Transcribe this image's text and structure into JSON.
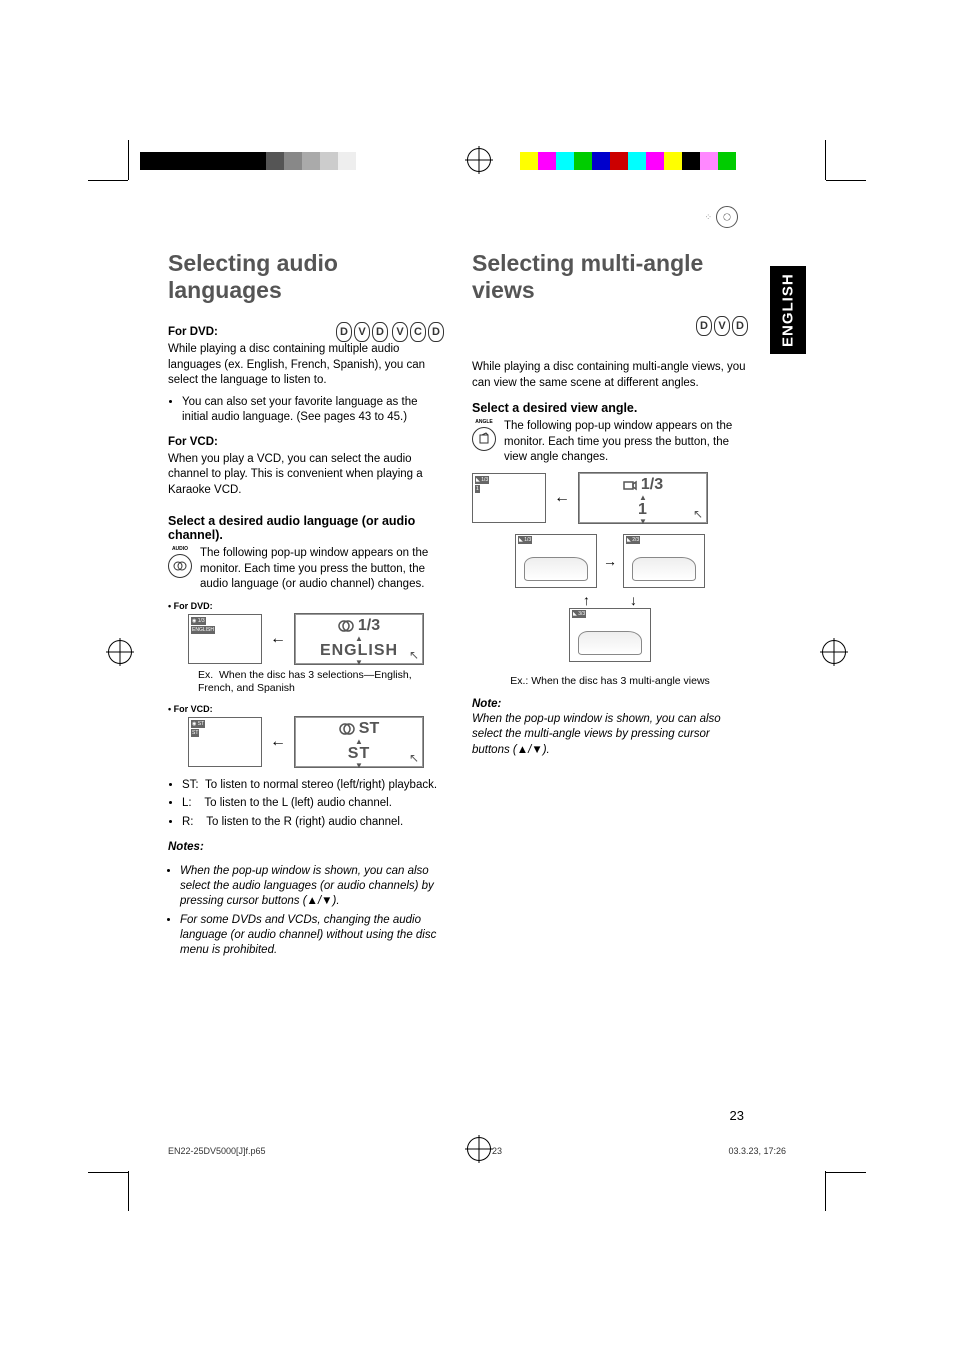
{
  "side_tab": "ENGLISH",
  "page_number": "23",
  "footer": {
    "file": "EN22-25DV5000[J]f.p65",
    "page": "23",
    "timestamp": "03.3.23, 17:26"
  },
  "left": {
    "heading": "Selecting audio languages",
    "for_dvd_label": "For DVD:",
    "for_dvd_body": "While playing a disc containing multiple audio languages (ex. English, French, Spanish), you can select the language to listen to.",
    "for_dvd_bullet": "You can also set your favorite language as the initial audio language. (See pages 43 to 45.)",
    "for_vcd_label": "For VCD:",
    "for_vcd_body": "When you play a VCD, you can select the audio channel to play. This is convenient when playing a Karaoke VCD.",
    "select_head": "Select a desired audio language (or audio channel).",
    "popup_body": "The following pop-up window appears on the monitor. Each time you press the button, the audio language (or audio channel) changes.",
    "button_label": "AUDIO",
    "for_dvd_tiny": "• For DVD:",
    "popup_dvd_top": "1/3",
    "popup_dvd_val": "ENGLISH",
    "caption_dvd_prefix": "Ex.",
    "caption_dvd": "When the disc has 3 selections—English, French, and Spanish",
    "for_vcd_tiny": "• For VCD:",
    "popup_vcd_top": "ST",
    "popup_vcd_val": "ST",
    "defs": {
      "st": "To listen to normal stereo (left/right) playback.",
      "l": "To listen to the L (left) audio channel.",
      "r": "To listen to the R (right) audio channel."
    },
    "def_labels": {
      "st": "ST:",
      "l": "L:",
      "r": "R:"
    },
    "notes_head": "Notes:",
    "notes": [
      "When the pop-up window is shown, you can also select the audio languages (or audio channels) by pressing cursor buttons (▲/▼).",
      "For some DVDs and VCDs, changing the audio language (or audio channel) without using the disc menu is prohibited."
    ]
  },
  "right": {
    "heading": "Selecting multi-angle views",
    "intro": "While playing a disc containing multi-angle views, you can view the same scene at different angles.",
    "select_head": "Select a desired view angle.",
    "popup_body": "The following pop-up window appears on the monitor. Each time you press the button, the view angle changes.",
    "button_label": "ANGLE",
    "popup_top": "1/3",
    "popup_val": "1",
    "caption": "Ex.: When the disc has 3 multi-angle views",
    "notes_head": "Note:",
    "note": "When the pop-up window is shown, you can also select the multi-angle views by pressing cursor buttons (▲/▼)."
  },
  "formats": {
    "dvd": "DVD",
    "vcd": "VCD"
  }
}
